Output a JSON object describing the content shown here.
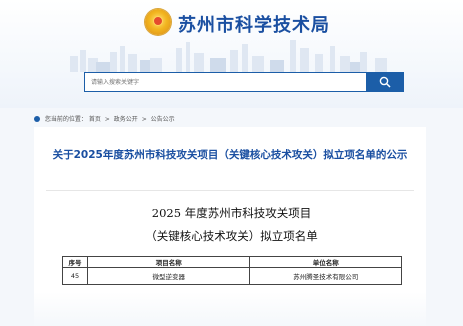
{
  "header": {
    "site_title": "苏州市科学技术局",
    "search": {
      "placeholder": "请输入搜索关键字"
    }
  },
  "breadcrumb": {
    "prefix": "您当前的位置：",
    "items": [
      "首页",
      "政务公开",
      "公告公示"
    ],
    "separator": ">"
  },
  "notice": {
    "title": "关于2025年度苏州市科技攻关项目（关键核心技术攻关）拟立项名单的公示"
  },
  "document": {
    "title_line1": "2025 年度苏州市科技攻关项目",
    "title_line2": "（关键核心技术攻关）拟立项名单",
    "table": {
      "headers": [
        "序号",
        "项目名称",
        "单位名称"
      ],
      "rows": [
        [
          "45",
          "微型逆变器",
          "苏州腾圣技术有限公司"
        ]
      ]
    }
  },
  "colors": {
    "brand_blue": "#1a4fa1",
    "search_blue": "#1c5ea8"
  }
}
